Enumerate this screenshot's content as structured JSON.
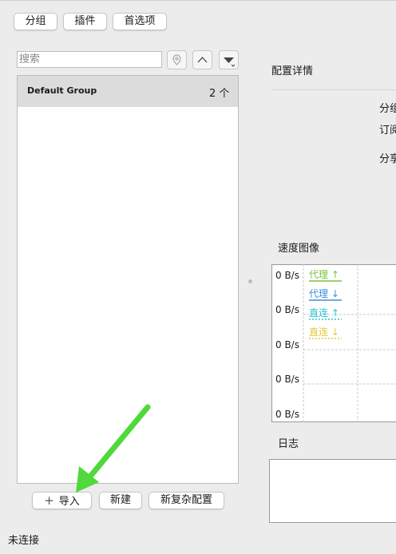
{
  "toolbar": {
    "group_label": "分组",
    "plugin_label": "插件",
    "prefs_label": "首选项"
  },
  "search": {
    "placeholder": "搜索"
  },
  "groups": [
    {
      "name": "Default Group",
      "count": "2 个"
    }
  ],
  "bottom_buttons": {
    "import_label": "导入",
    "new_label": "新建",
    "complex_label": "新复杂配置"
  },
  "status": "未连接",
  "detail": {
    "title": "配置详情",
    "row1": "分组",
    "row2": "订阅",
    "row3": "分享"
  },
  "speed": {
    "title": "速度图像",
    "y_ticks": [
      "0 B/s",
      "0 B/s",
      "0 B/s",
      "0 B/s",
      "0 B/s"
    ],
    "legend": [
      {
        "label": "代理 ↑",
        "color": "#7cc242"
      },
      {
        "label": "代理 ↓",
        "color": "#3a8fd6"
      },
      {
        "label": "直连 ↑",
        "color": "#2bc3d6"
      },
      {
        "label": "直连 ↓",
        "color": "#e8c93a"
      }
    ]
  },
  "log": {
    "title": "日志"
  },
  "colors": {
    "arrow": "#4fd93a",
    "background": "#ececec"
  }
}
